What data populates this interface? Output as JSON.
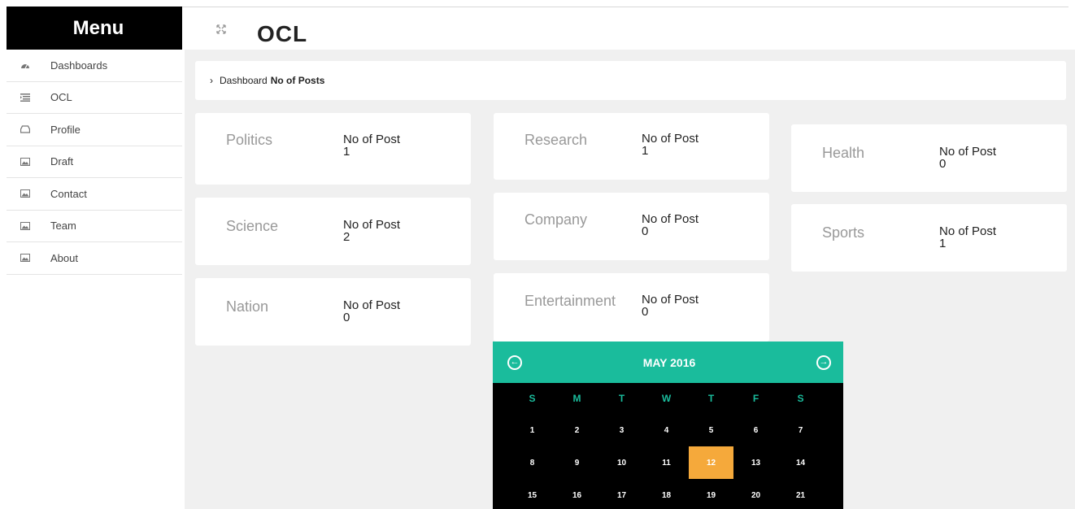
{
  "sidebar": {
    "title": "Menu",
    "items": [
      {
        "label": "Dashboards",
        "icon": "dashboard-icon"
      },
      {
        "label": "OCL",
        "icon": "list-icon"
      },
      {
        "label": "Profile",
        "icon": "inbox-icon"
      },
      {
        "label": "Draft",
        "icon": "image-icon"
      },
      {
        "label": "Contact",
        "icon": "image-icon"
      },
      {
        "label": "Team",
        "icon": "image-icon"
      },
      {
        "label": "About",
        "icon": "image-icon"
      }
    ]
  },
  "header": {
    "title": "OCL"
  },
  "breadcrumb": {
    "home": "Dashboard",
    "current": "No of Posts"
  },
  "cards": [
    {
      "category": "Politics",
      "stat_label": "No of Post",
      "count": "1"
    },
    {
      "category": "Science",
      "stat_label": "No of Post",
      "count": "2"
    },
    {
      "category": "Nation",
      "stat_label": "No of Post",
      "count": "0"
    },
    {
      "category": "Research",
      "stat_label": "No of Post",
      "count": "1"
    },
    {
      "category": "Company",
      "stat_label": "No of Post",
      "count": "0"
    },
    {
      "category": "Entertainment",
      "stat_label": "No of Post",
      "count": "0"
    },
    {
      "category": "Health",
      "stat_label": "No of Post",
      "count": "0"
    },
    {
      "category": "Sports",
      "stat_label": "No of Post",
      "count": "1"
    }
  ],
  "calendar": {
    "title": "MAY 2016",
    "prev_icon": "arrow-left-circle-icon",
    "next_icon": "arrow-right-circle-icon",
    "days_of_week": [
      "S",
      "M",
      "T",
      "W",
      "T",
      "F",
      "S"
    ],
    "weeks": [
      [
        "1",
        "2",
        "3",
        "4",
        "5",
        "6",
        "7"
      ],
      [
        "8",
        "9",
        "10",
        "11",
        "12",
        "13",
        "14"
      ],
      [
        "15",
        "16",
        "17",
        "18",
        "19",
        "20",
        "21"
      ]
    ],
    "today": "12"
  },
  "colors": {
    "accent": "#1abc9c",
    "today": "#f5a93b",
    "sidebar_header_bg": "#000000",
    "content_bg": "#f0f0f0"
  }
}
